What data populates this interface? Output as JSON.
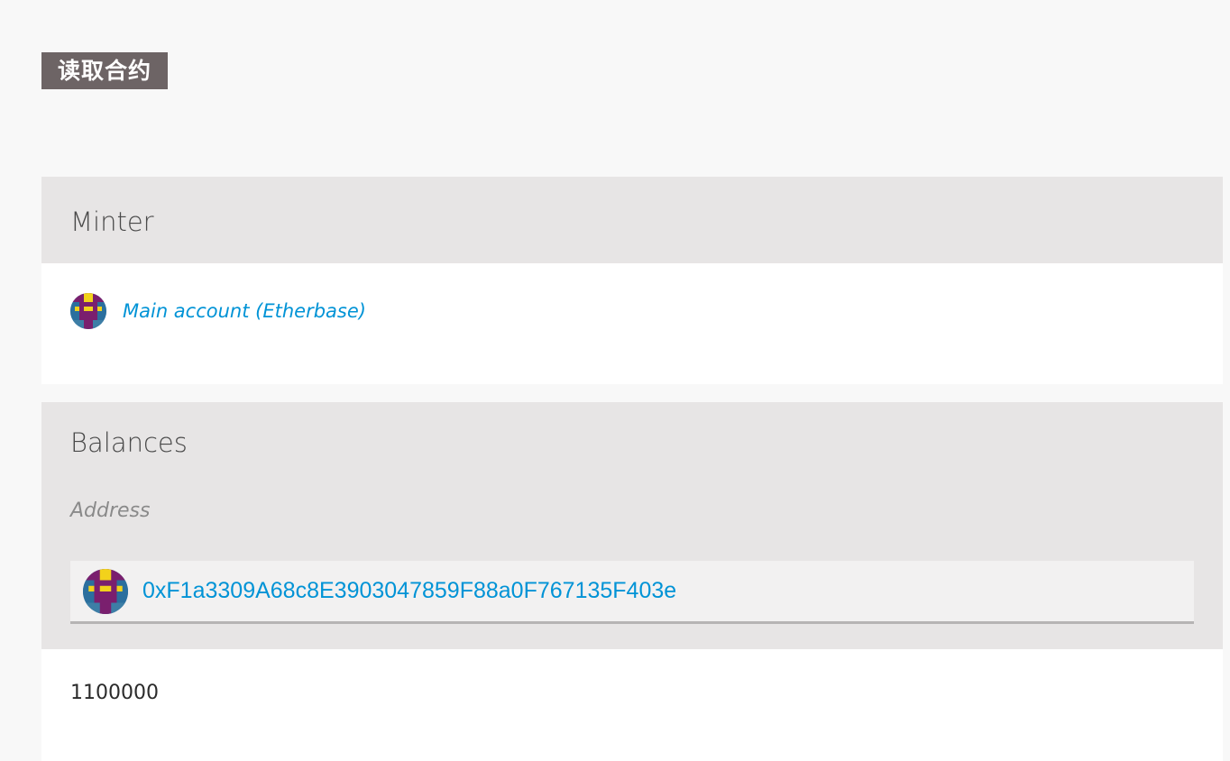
{
  "section": {
    "title": "读取合约"
  },
  "minter": {
    "title": "Minter",
    "account": {
      "label": "Main account (Etherbase)",
      "icon": "identicon-icon"
    }
  },
  "balances": {
    "title": "Balances",
    "address_label": "Address",
    "address_value": "0xF1a3309A68c8E3903047859F88a0F767135F403e",
    "result": "1100000"
  },
  "colors": {
    "header_bg": "#6d6465",
    "panel_head_bg": "#e7e5e5",
    "link": "#0093d6"
  }
}
